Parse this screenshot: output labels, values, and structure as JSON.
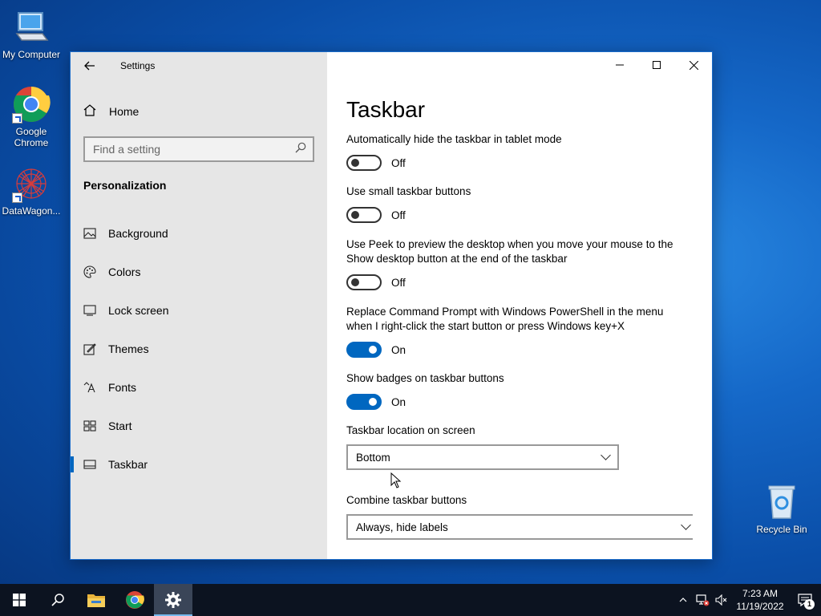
{
  "desktop": {
    "icons": [
      {
        "label": "My Computer"
      },
      {
        "label": "Google Chrome"
      },
      {
        "label": "DataWagon..."
      },
      {
        "label": "Recycle Bin"
      }
    ]
  },
  "window": {
    "title": "Settings",
    "sidebar": {
      "home_label": "Home",
      "search_placeholder": "Find a setting",
      "section_title": "Personalization",
      "items": [
        {
          "label": "Background",
          "icon": "image-icon"
        },
        {
          "label": "Colors",
          "icon": "palette-icon"
        },
        {
          "label": "Lock screen",
          "icon": "lock-screen-icon"
        },
        {
          "label": "Themes",
          "icon": "themes-icon"
        },
        {
          "label": "Fonts",
          "icon": "fonts-icon"
        },
        {
          "label": "Start",
          "icon": "start-icon"
        },
        {
          "label": "Taskbar",
          "icon": "taskbar-icon",
          "active": true
        }
      ]
    },
    "content": {
      "page_title": "Taskbar",
      "settings": [
        {
          "label": "Automatically hide the taskbar in tablet mode",
          "state": "Off",
          "on": false
        },
        {
          "label": "Use small taskbar buttons",
          "state": "Off",
          "on": false
        },
        {
          "label": "Use Peek to preview the desktop when you move your mouse to the Show desktop button at the end of the taskbar",
          "state": "Off",
          "on": false
        },
        {
          "label": "Replace Command Prompt with Windows PowerShell in the menu when I right-click the start button or press Windows key+X",
          "state": "On",
          "on": true
        },
        {
          "label": "Show badges on taskbar buttons",
          "state": "On",
          "on": true
        }
      ],
      "location": {
        "label": "Taskbar location on screen",
        "value": "Bottom"
      },
      "combine": {
        "label": "Combine taskbar buttons",
        "value": "Always, hide labels"
      }
    }
  },
  "taskbar": {
    "time": "7:23 AM",
    "date": "11/19/2022",
    "notification_count": "1"
  },
  "colors": {
    "accent": "#0067c0"
  }
}
